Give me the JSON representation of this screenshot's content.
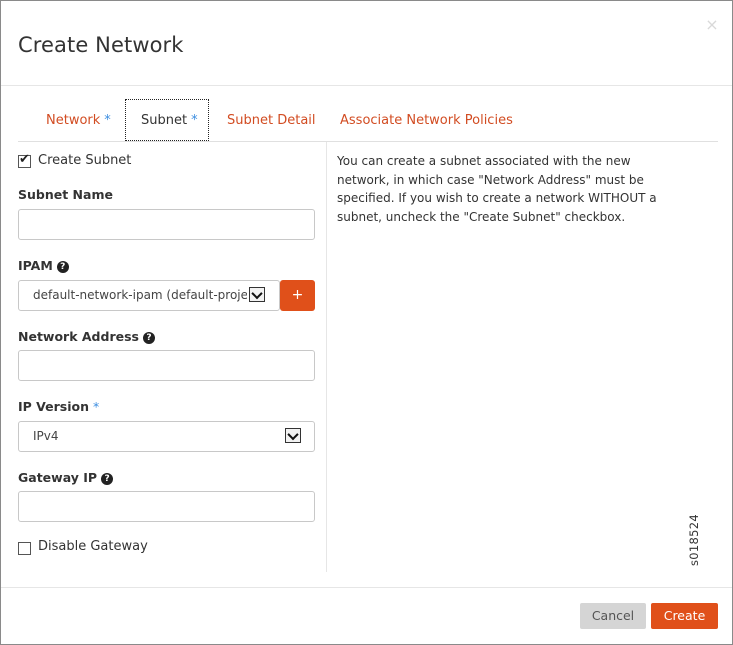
{
  "dialog": {
    "title": "Create Network",
    "close_glyph": "×"
  },
  "tabs": [
    {
      "label": "Network",
      "required_marker": "*",
      "active": false
    },
    {
      "label": "Subnet",
      "required_marker": "*",
      "active": true
    },
    {
      "label": "Subnet Detail",
      "required_marker": "",
      "active": false
    },
    {
      "label": "Associate Network Policies",
      "required_marker": "",
      "active": false
    }
  ],
  "form": {
    "create_subnet": {
      "label": "Create Subnet",
      "checked": true
    },
    "subnet_name": {
      "label": "Subnet Name",
      "value": ""
    },
    "ipam": {
      "label": "IPAM",
      "help_icon": "question-circle-icon",
      "selected": "default-network-ipam (default-project)",
      "add_label": "+"
    },
    "network_address": {
      "label": "Network Address",
      "help_icon": "question-circle-icon",
      "value": ""
    },
    "ip_version": {
      "label": "IP Version",
      "required_marker": "*",
      "selected": "IPv4"
    },
    "gateway_ip": {
      "label": "Gateway IP",
      "help_icon": "question-circle-icon",
      "value": ""
    },
    "disable_gateway": {
      "label": "Disable Gateway",
      "checked": false
    }
  },
  "help_text": "You can create a subnet associated with the new network, in which case \"Network Address\" must be specified. If you wish to create a network WITHOUT a subnet, uncheck the \"Create Subnet\" checkbox.",
  "watermark": "s018524",
  "footer": {
    "cancel_label": "Cancel",
    "create_label": "Create"
  },
  "colors": {
    "accent": "#e0501a",
    "tab_link": "#d24c22",
    "required": "#3b8de0"
  }
}
